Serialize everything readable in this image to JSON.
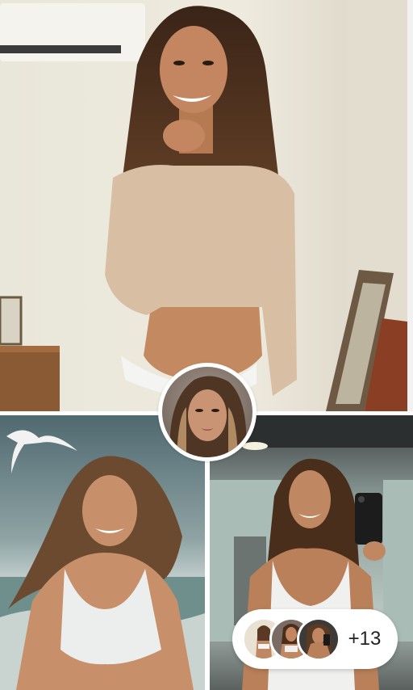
{
  "gallery": {
    "photos": [
      {
        "name": "photo-main"
      },
      {
        "name": "photo-beach"
      },
      {
        "name": "photo-gym-selfie"
      }
    ],
    "more_count_label": "+13"
  },
  "colors": {
    "background": "#ffffff",
    "pill_background": "#ffffff",
    "count_text": "#222222"
  }
}
